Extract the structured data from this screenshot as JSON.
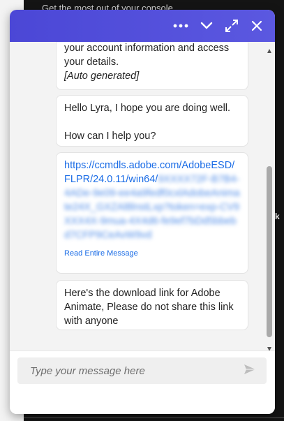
{
  "background": {
    "top_text": "Get the most out of your console",
    "right_edge_text": "k"
  },
  "header": {
    "gradient_start": "#4b47d6",
    "gradient_end": "#5b58e0",
    "icons": [
      "more-icon",
      "chevron-down-icon",
      "expand-icon",
      "close-icon"
    ]
  },
  "messages": [
    {
      "lines": [
        "your account information and access",
        "your details."
      ],
      "auto_label": "[Auto generated]"
    },
    {
      "greeting": "Hello Lyra, I hope you are doing well.",
      "question": "How can I help you?"
    },
    {
      "link_visible": "https://ccmdls.adobe.com/AdobeESD/FLPR/24.0.11/win64/",
      "link_blurred": "9XXXX72F-B7B4-4ADe-9e09-ee4a9fedf0cxlAdobeAnimate24X_GXZAl8lnstLxp?token=exp-CV9XXX4X-9mua-4X4d6-fe9ef7bDd5bbebd7CFP9CeAvW9vd",
      "read_more": "Read Entire Message"
    },
    {
      "text": "Here's the download link for Adobe Animate, Please do not share this link with anyone"
    }
  ],
  "composer": {
    "placeholder": "Type your message here",
    "value": ""
  },
  "colors": {
    "link": "#1a6ce6",
    "chat_bg": "#f3f3f3",
    "bubble_bg": "#ffffff",
    "scroll_thumb": "#a9a9a9"
  },
  "scroll": {
    "position": 0.95
  }
}
